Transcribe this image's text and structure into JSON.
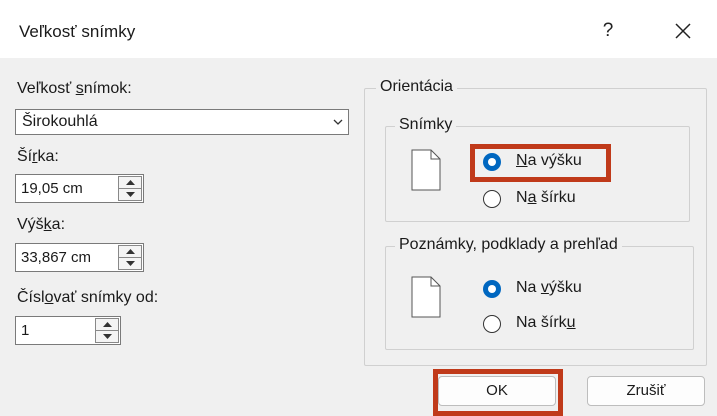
{
  "window": {
    "title": "Veľkosť snímky",
    "help": "?"
  },
  "left": {
    "size_label_pre": "Veľkosť ",
    "size_label_ul": "s",
    "size_label_post": "nímok:",
    "size_value": "Širokouhlá",
    "width_label_pre": "Ší",
    "width_label_ul": "r",
    "width_label_post": "ka:",
    "width_value": "19,05 cm",
    "height_label_pre": "Výš",
    "height_label_ul": "k",
    "height_label_post": "a:",
    "height_value": "33,867 cm",
    "number_label_pre": "Čísl",
    "number_label_ul": "o",
    "number_label_post": "vať snímky od:",
    "number_value": "1"
  },
  "orientation": {
    "title": "Orientácia",
    "slides": {
      "title": "Snímky",
      "portrait_ul": "N",
      "portrait_post": "a výšku",
      "landscape_pre": "N",
      "landscape_ul": "a",
      "landscape_post": " šírku"
    },
    "notes": {
      "title": "Poznámky, podklady a prehľad",
      "portrait_pre": "Na ",
      "portrait_ul": "v",
      "portrait_post": "ýšku",
      "landscape_pre": "Na šírk",
      "landscape_ul": "u"
    }
  },
  "buttons": {
    "ok": "OK",
    "cancel": "Zrušiť"
  },
  "colors": {
    "accent": "#0067c0",
    "highlight": "#c03a1a"
  }
}
